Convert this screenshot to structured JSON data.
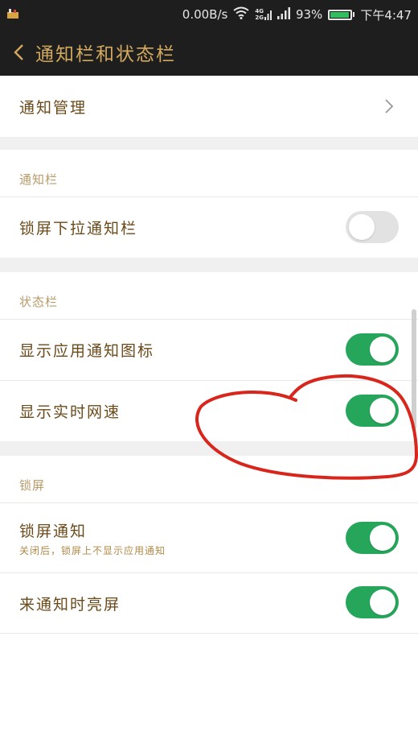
{
  "status_bar": {
    "net_speed": "0.00B/s",
    "net_type_top": "4G",
    "net_type_bottom": "2G",
    "battery_percent": "93%",
    "battery_level": 0.93,
    "time": "下午4:47",
    "icons": [
      "app-notification-icon",
      "wifi-icon",
      "mobile-data-icon",
      "signal-icon",
      "battery-icon"
    ]
  },
  "header": {
    "title": "通知栏和状态栏",
    "back_icon": "chevron-left-icon"
  },
  "items": {
    "notification_management": {
      "label": "通知管理",
      "icon": "chevron-right-icon"
    },
    "notification_section": "通知栏",
    "lockscreen_pulldown": {
      "label": "锁屏下拉通知栏",
      "on": false
    },
    "statusbar_section": "状态栏",
    "show_app_icons": {
      "label": "显示应用通知图标",
      "on": true
    },
    "show_net_speed": {
      "label": "显示实时网速",
      "on": true
    },
    "lockscreen_section": "锁屏",
    "lockscreen_notification": {
      "label": "锁屏通知",
      "sublabel": "关闭后，锁屏上不显示应用通知",
      "on": true
    },
    "wake_on_notification": {
      "label": "来通知时亮屏",
      "on": true
    }
  },
  "colors": {
    "header_bg": "#1e1e1e",
    "accent_gold": "#d2a95e",
    "label_brown": "#6b4a1a",
    "toggle_on": "#26a65b",
    "toggle_off": "#e2e2e2",
    "annotation_red": "#d9261c"
  }
}
